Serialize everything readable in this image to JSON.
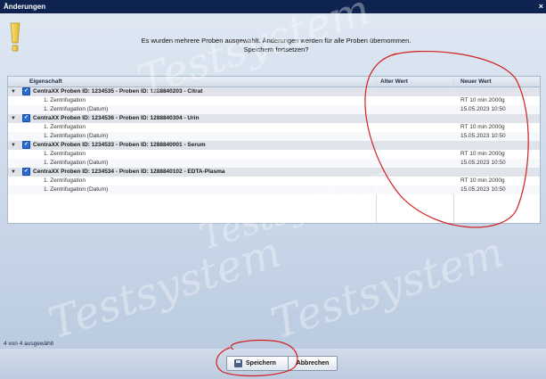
{
  "window": {
    "title": "Änderungen",
    "close_glyph": "×"
  },
  "message": {
    "line1": "Es wurden mehrere Proben ausgewählt.  Änderungen werden für alle Proben übernommen.",
    "line2": "Speichern fortsetzen?"
  },
  "grid": {
    "headers": {
      "property": "Eigenschaft",
      "old_value": "Alter Wert",
      "new_value": "Neuer Wert"
    },
    "groups": [
      {
        "label": "CentraXX Proben ID: 1234535 - Proben ID: 1288840203 - Citrat",
        "rows": [
          {
            "property": "1. Zentrifugation",
            "old": "",
            "new": "RT 10 min 2000g"
          },
          {
            "property": "1. Zentrifugation (Datum)",
            "old": "",
            "new": "15.05.2023 10:50"
          }
        ]
      },
      {
        "label": "CentraXX Proben ID: 1234536 - Proben ID: 1288840304 - Urin",
        "rows": [
          {
            "property": "1. Zentrifugation",
            "old": "",
            "new": "RT 10 min 2000g"
          },
          {
            "property": "1. Zentrifugation (Datum)",
            "old": "",
            "new": "15.05.2023 10:50"
          }
        ]
      },
      {
        "label": "CentraXX Proben ID: 1234533 - Proben ID: 1288840001 - Serum",
        "rows": [
          {
            "property": "1. Zentrifugation",
            "old": "",
            "new": "RT 10 min 2000g"
          },
          {
            "property": "1. Zentrifugation (Datum)",
            "old": "",
            "new": "15.05.2023 10:50"
          }
        ]
      },
      {
        "label": "CentraXX Proben ID: 1234534 - Proben ID: 1288840102 - EDTA-Plasma",
        "rows": [
          {
            "property": "1. Zentrifugation",
            "old": "",
            "new": "RT 10 min 2000g"
          },
          {
            "property": "1. Zentrifugation (Datum)",
            "old": "",
            "new": "15.05.2023 10:50"
          }
        ]
      }
    ]
  },
  "status": {
    "selection_text": "4 von 4 ausgewählt"
  },
  "buttons": {
    "save_label": "Speichern",
    "cancel_label": "Abbrechen"
  },
  "icons": {
    "warning": "warning-icon",
    "expand": "expand-arrow-icon",
    "check": "checkbox-checked-icon",
    "save": "floppy-disk-icon"
  },
  "colors": {
    "titlebar": "#0f2350",
    "annotation": "#d21f1f",
    "checkbox": "#2a6bd4"
  }
}
